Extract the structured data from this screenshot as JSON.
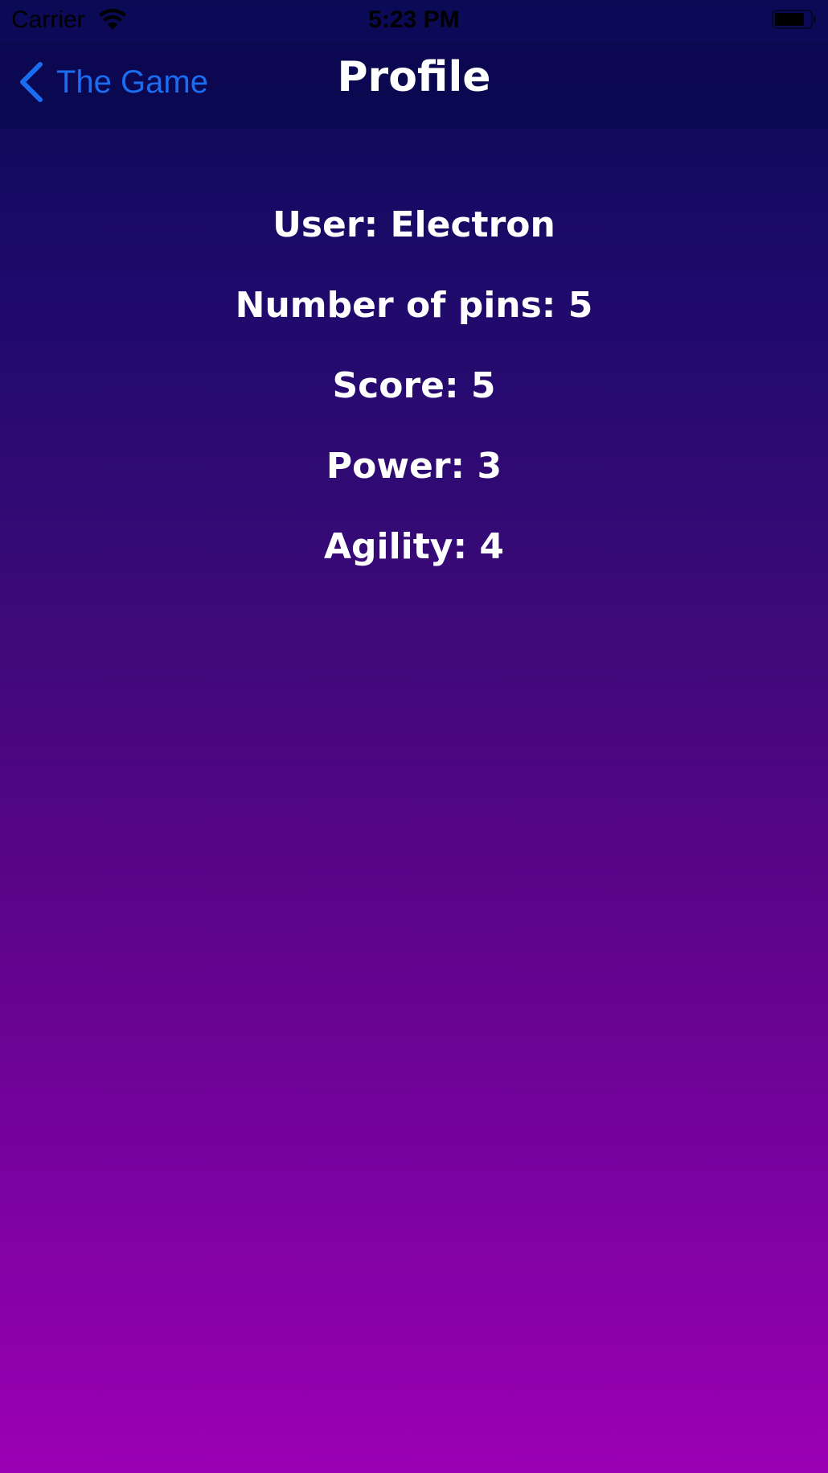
{
  "status_bar": {
    "carrier": "Carrier",
    "time": "5:23 PM"
  },
  "nav": {
    "back_label": "The Game",
    "title": "Profile"
  },
  "profile": {
    "user": "User: Electron",
    "pins": "Number of pins: 5",
    "score": "Score: 5",
    "power": "Power: 3",
    "agility": "Agility: 4"
  },
  "colors": {
    "gradient_top": "#0a0a55",
    "gradient_bottom": "#9c00b4",
    "back_button": "#1a6cf0",
    "text": "#ffffff"
  }
}
